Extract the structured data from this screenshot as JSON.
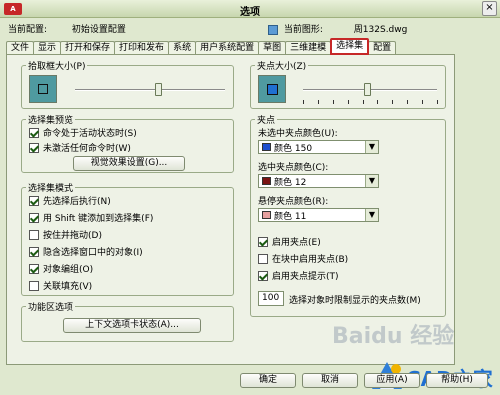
{
  "window": {
    "title": "选项",
    "logo_text": "A",
    "close_label": "×"
  },
  "config": {
    "current_config_label": "当前配置:",
    "current_config_value": "初始设置配置",
    "current_drawing_label": "当前图形:",
    "current_drawing_value": "周132S.dwg"
  },
  "tabs": [
    {
      "label": "文件"
    },
    {
      "label": "显示"
    },
    {
      "label": "打开和保存"
    },
    {
      "label": "打印和发布"
    },
    {
      "label": "系统"
    },
    {
      "label": "用户系统配置"
    },
    {
      "label": "草图"
    },
    {
      "label": "三维建模"
    },
    {
      "label": "选择集",
      "active": true
    },
    {
      "label": "配置"
    }
  ],
  "pickbox": {
    "legend": "拾取框大小(P)",
    "level": 0.55
  },
  "grip_size": {
    "legend": "夹点大小(Z)",
    "level": 0.48,
    "color": "#1f6fd1"
  },
  "preview": {
    "legend": "选择集预览",
    "items": [
      {
        "label": "命令处于活动状态时(S)",
        "checked": true
      },
      {
        "label": "未激活任何命令时(W)",
        "checked": true
      }
    ],
    "button": "视觉效果设置(G)..."
  },
  "modes": {
    "legend": "选择集模式",
    "items": [
      {
        "label": "先选择后执行(N)",
        "checked": true
      },
      {
        "label": "用 Shift 键添加到选择集(F)",
        "checked": true
      },
      {
        "label": "按住并拖动(D)",
        "checked": false
      },
      {
        "label": "隐含选择窗口中的对象(I)",
        "checked": true
      },
      {
        "label": "对象编组(O)",
        "checked": true
      },
      {
        "label": "关联填充(V)",
        "checked": false
      }
    ]
  },
  "ribbon": {
    "legend": "功能区选项",
    "button": "上下文选项卡状态(A)..."
  },
  "grips": {
    "legend": "夹点",
    "unselected": {
      "label": "未选中夹点颜色(U):",
      "value": "颜色 150",
      "color": "#1f4fd1"
    },
    "selected": {
      "label": "选中夹点颜色(C):",
      "value": "颜色 12",
      "color": "#7a1414"
    },
    "hover": {
      "label": "悬停夹点颜色(R):",
      "value": "颜色 11",
      "color": "#e6a0a0"
    },
    "checks": [
      {
        "label": "启用夹点(E)",
        "checked": true
      },
      {
        "label": "在块中启用夹点(B)",
        "checked": false
      },
      {
        "label": "启用夹点提示(T)",
        "checked": true
      }
    ],
    "limit_value": "100",
    "limit_label": "选择对象时限制显示的夹点数(M)"
  },
  "footer": {
    "ok": "确定",
    "cancel": "取消",
    "apply": "应用(A)",
    "help": "帮助(H)"
  },
  "watermark": {
    "text": "Baidu 经验",
    "logo": "CAD之家"
  }
}
